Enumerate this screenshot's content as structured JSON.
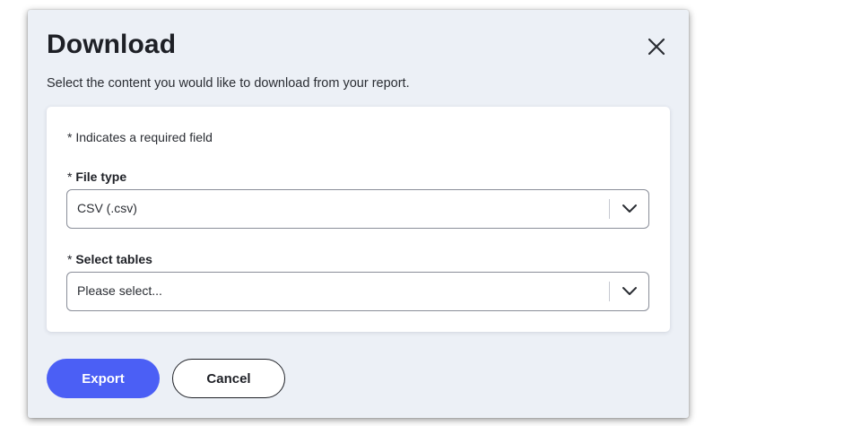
{
  "dialog": {
    "title": "Download",
    "subtitle": "Select the content you would like to download from your report.",
    "required_note": "* Indicates a required field",
    "fields": [
      {
        "required_mark": "* ",
        "label": "File type",
        "value": "CSV (.csv)"
      },
      {
        "required_mark": "* ",
        "label": "Select tables",
        "value": "Please select..."
      }
    ],
    "buttons": {
      "export": "Export",
      "cancel": "Cancel"
    }
  },
  "colors": {
    "primary": "#4b5ff5",
    "dialog_background": "#ecf0f6",
    "text": "#1e2026"
  },
  "icons": {
    "close": "close-icon",
    "dropdown": "chevron-down-icon"
  }
}
